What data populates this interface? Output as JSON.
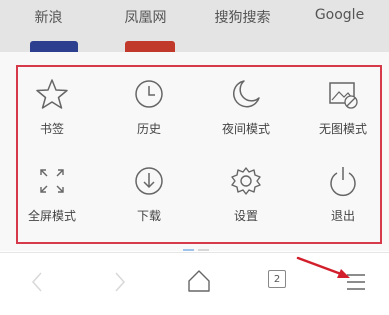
{
  "quick_links": [
    {
      "label": "新浪",
      "color": "#2d3f8f"
    },
    {
      "label": "凤凰网",
      "color": "#c0392b"
    },
    {
      "label": "搜狗搜索",
      "color": ""
    },
    {
      "label": "Google",
      "color": ""
    }
  ],
  "menu": {
    "items": [
      {
        "label": "书签",
        "icon": "star-icon"
      },
      {
        "label": "历史",
        "icon": "clock-icon"
      },
      {
        "label": "夜间模式",
        "icon": "moon-icon"
      },
      {
        "label": "无图模式",
        "icon": "no-image-icon"
      },
      {
        "label": "全屏模式",
        "icon": "fullscreen-icon"
      },
      {
        "label": "下载",
        "icon": "download-icon"
      },
      {
        "label": "设置",
        "icon": "gear-icon"
      },
      {
        "label": "退出",
        "icon": "power-icon"
      }
    ]
  },
  "toolbar": {
    "tab_count": "2",
    "back_enabled": false,
    "forward_enabled": false
  },
  "colors": {
    "highlight": "#d63a4a",
    "arrow": "#d21f2b",
    "page_dot_active": "#9fc3ea"
  }
}
